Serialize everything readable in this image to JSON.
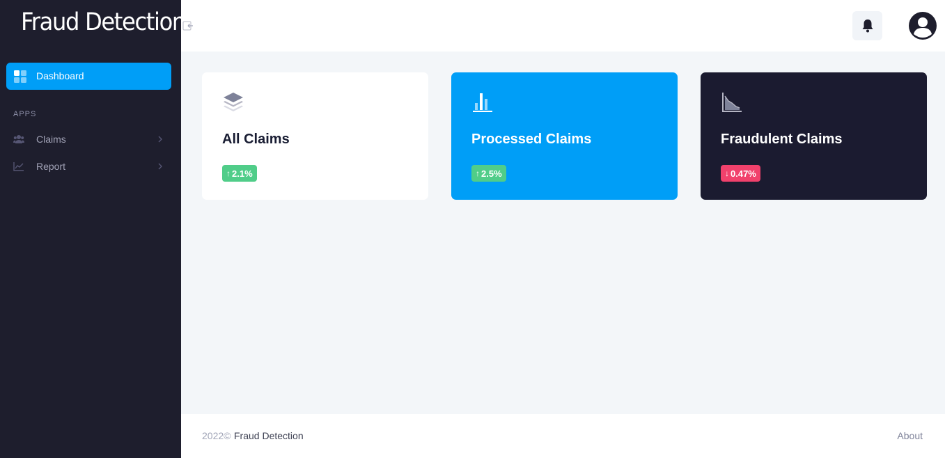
{
  "app": {
    "brand": "Fraud Detection"
  },
  "sidebar": {
    "active_item": {
      "label": "Dashboard",
      "icon": "dashboard-grid-icon"
    },
    "section_label": "APPS",
    "items": [
      {
        "label": "Claims",
        "icon": "users-icon"
      },
      {
        "label": "Report",
        "icon": "line-chart-icon"
      }
    ]
  },
  "header": {
    "notification_icon": "bell-icon",
    "avatar_icon": "user-circle-icon"
  },
  "cards": [
    {
      "title": "All Claims",
      "icon": "layers-icon",
      "change": "2.1%",
      "direction": "up",
      "badge_color": "#50cd89"
    },
    {
      "title": "Processed Claims",
      "icon": "bar-chart-icon",
      "change": "2.5%",
      "direction": "up",
      "badge_color": "#50cd89"
    },
    {
      "title": "Fraudulent Claims",
      "icon": "area-chart-icon",
      "change": "0.47%",
      "direction": "down",
      "badge_color": "#f1416c"
    }
  ],
  "footer": {
    "year": "2022©",
    "name": "Fraud Detection",
    "about": "About"
  },
  "colors": {
    "primary": "#009ef7",
    "sidebar_bg": "#1e1e2d",
    "dark_card": "#1b1b30",
    "success": "#50cd89",
    "danger": "#f1416c"
  }
}
